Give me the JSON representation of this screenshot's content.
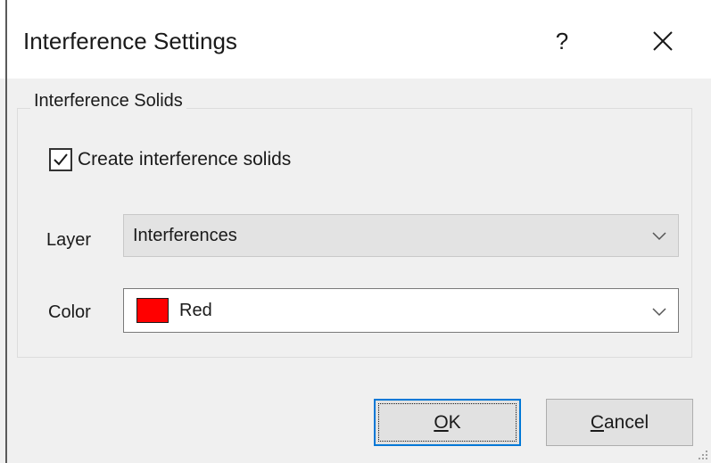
{
  "window": {
    "title": "Interference Settings",
    "help_label": "?",
    "close_label": "×"
  },
  "group": {
    "legend": "Interference Solids",
    "checkbox": {
      "label": "Create interference solids",
      "checked": true
    },
    "layer": {
      "label": "Layer",
      "selected": "Interferences",
      "icon": "chevron-down-icon"
    },
    "color": {
      "label": "Color",
      "selected": "Red",
      "swatch_color": "#ff0000",
      "icon": "chevron-down-icon"
    }
  },
  "buttons": {
    "ok": {
      "mnemonic": "O",
      "rest": "K"
    },
    "cancel": {
      "mnemonic": "C",
      "rest": "ancel"
    }
  },
  "colors": {
    "dialog_background": "#f0f0f0",
    "titlebar_background": "#ffffff",
    "default_button_border": "#0078d7"
  }
}
